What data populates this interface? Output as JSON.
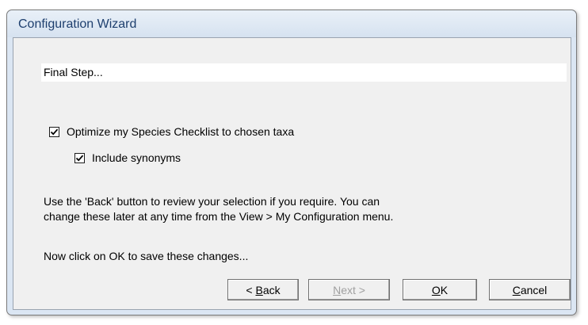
{
  "window": {
    "title": "Configuration Wizard"
  },
  "step": {
    "label": "Final Step..."
  },
  "options": [
    {
      "label": "Optimize my Species Checklist to chosen taxa",
      "checked": true
    },
    {
      "label": "Include synonyms",
      "checked": true
    }
  ],
  "info": {
    "line1": "Use the 'Back' button to review your selection if you require.  You can",
    "line2": "change these later at any time from the View > My Configuration menu.",
    "prompt": "Now click on OK to save these changes..."
  },
  "buttons": {
    "back": {
      "prefix": "< ",
      "mnemonic": "B",
      "rest": "ack",
      "enabled": true
    },
    "next": {
      "mnemonic": "N",
      "rest": "ext >",
      "enabled": false
    },
    "ok": {
      "mnemonic": "O",
      "rest": "K",
      "enabled": true
    },
    "cancel": {
      "mnemonic": "C",
      "rest": "ancel",
      "enabled": true
    }
  },
  "icons": [
    "checkmark-icon"
  ],
  "colors": {
    "title_text": "#1e3f6e",
    "frame": "#dbe6f3",
    "client_bg": "#f0f0f0"
  }
}
